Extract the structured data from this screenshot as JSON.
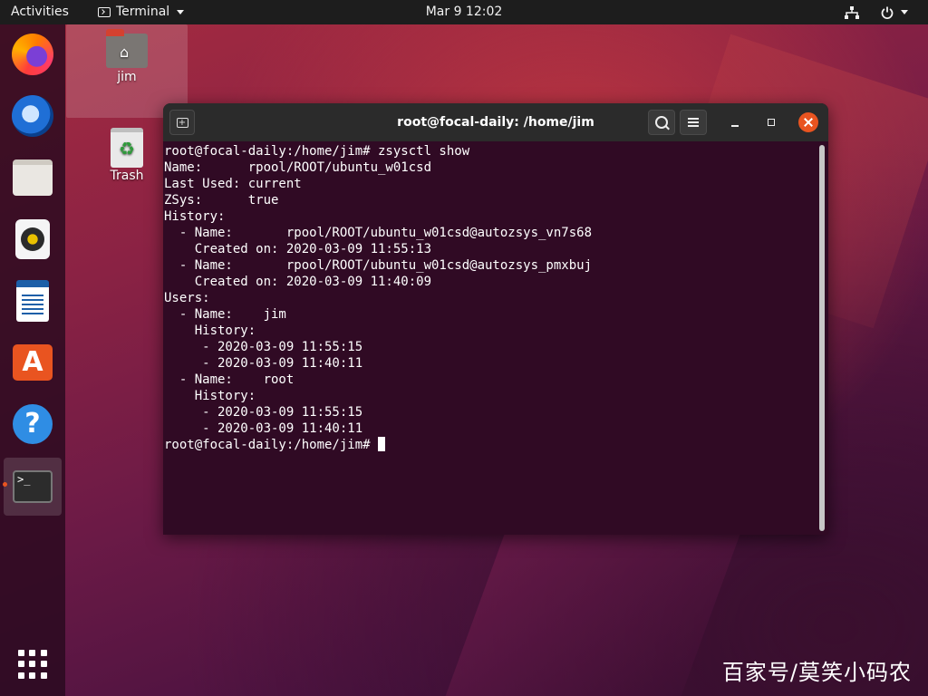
{
  "topbar": {
    "activities": "Activities",
    "app_menu": "Terminal",
    "clock": "Mar 9  12:02",
    "network_icon": "network-wired-icon",
    "power_icon": "power-icon"
  },
  "dock": {
    "items": [
      {
        "name": "firefox",
        "icon": "firefox-icon"
      },
      {
        "name": "thunderbird",
        "icon": "thunderbird-icon"
      },
      {
        "name": "files",
        "icon": "files-icon"
      },
      {
        "name": "rhythmbox",
        "icon": "rhythmbox-icon"
      },
      {
        "name": "libreoffice-writer",
        "icon": "writer-icon"
      },
      {
        "name": "ubuntu-software",
        "icon": "software-icon"
      },
      {
        "name": "help",
        "icon": "help-icon"
      },
      {
        "name": "terminal",
        "icon": "terminal-icon",
        "active": true
      }
    ],
    "software_glyph": "A",
    "help_glyph": "?",
    "terminal_glyph": ">_",
    "apps_icon": "show-applications-icon"
  },
  "desktop": {
    "home_label": "jim",
    "trash_label": "Trash",
    "home_glyph": "⌂",
    "trash_glyph": "♻"
  },
  "window": {
    "title": "root@focal-daily: /home/jim",
    "newtab_glyph": "+",
    "lines": [
      "root@focal-daily:/home/jim# zsysctl show",
      "Name:      rpool/ROOT/ubuntu_w01csd",
      "Last Used: current",
      "ZSys:      true",
      "History:",
      "  - Name:       rpool/ROOT/ubuntu_w01csd@autozsys_vn7s68",
      "    Created on: 2020-03-09 11:55:13",
      "  - Name:       rpool/ROOT/ubuntu_w01csd@autozsys_pmxbuj",
      "    Created on: 2020-03-09 11:40:09",
      "Users:",
      "  - Name:    jim",
      "    History:",
      "     - 2020-03-09 11:55:15",
      "     - 2020-03-09 11:40:11",
      "  - Name:    root",
      "    History:",
      "     - 2020-03-09 11:55:15",
      "     - 2020-03-09 11:40:11"
    ],
    "prompt": "root@focal-daily:/home/jim# "
  },
  "watermark": "百家号/莫笑小码农",
  "colors": {
    "terminal_bg": "#300a24",
    "accent": "#e95420",
    "topbar_bg": "#1d1d1d"
  }
}
